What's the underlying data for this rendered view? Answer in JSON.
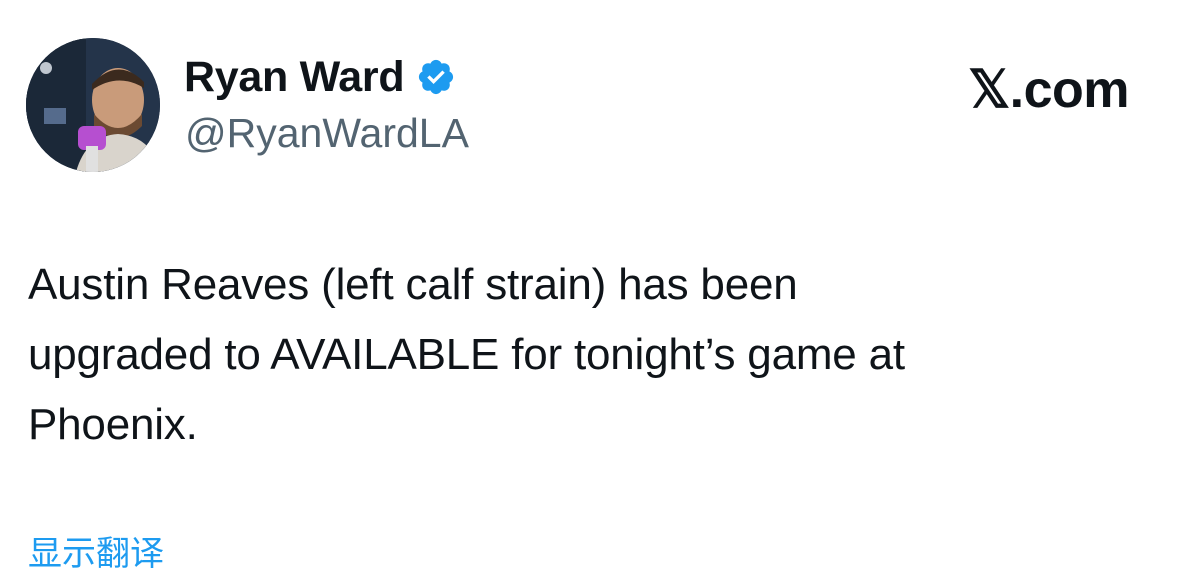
{
  "tweet": {
    "author": {
      "display_name": "Ryan Ward",
      "handle": "@RyanWardLA",
      "verified": true,
      "verified_icon": "verified-badge-icon",
      "verified_color": "#1d9bf0"
    },
    "brand_label": "𝕏.com",
    "text": "Austin Reaves (left calf strain) has been\nupgraded to AVAILABLE for tonight’s game at\nPhoenix.",
    "translate_label": "显示翻译",
    "colors": {
      "text": "#0f1419",
      "handle": "#536471",
      "link": "#1d9bf0"
    }
  }
}
